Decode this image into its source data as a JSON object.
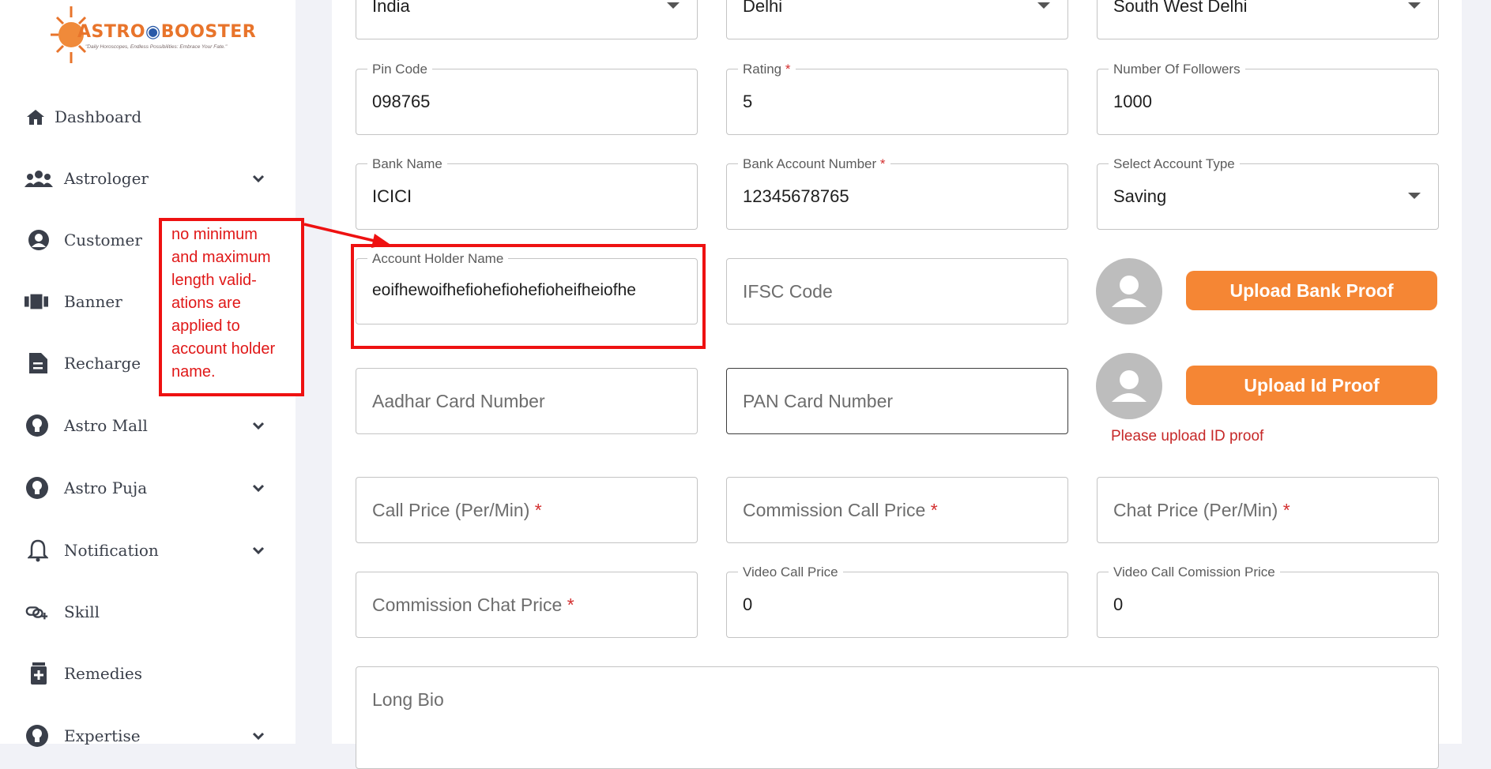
{
  "brand": {
    "name_part1": "ASTRO",
    "name_part2": "BOOSTER",
    "tagline": "\"Daily Horoscopes, Endless Possibilities: Embrace Your Fate.\""
  },
  "sidebar": {
    "items": [
      {
        "label": "Dashboard",
        "icon": "home-icon",
        "has_chevron": false
      },
      {
        "label": "Astrologer",
        "icon": "users-icon",
        "has_chevron": true
      },
      {
        "label": "Customer",
        "icon": "user-circle-icon",
        "has_chevron": false
      },
      {
        "label": "Banner",
        "icon": "banner-icon",
        "has_chevron": false
      },
      {
        "label": "Recharge",
        "icon": "document-icon",
        "has_chevron": false
      },
      {
        "label": "Astro Mall",
        "icon": "lightbulb-icon",
        "has_chevron": true
      },
      {
        "label": "Astro Puja",
        "icon": "lightbulb-icon",
        "has_chevron": true
      },
      {
        "label": "Notification",
        "icon": "bell-icon",
        "has_chevron": true
      },
      {
        "label": "Skill",
        "icon": "link-plus-icon",
        "has_chevron": false
      },
      {
        "label": "Remedies",
        "icon": "medical-icon",
        "has_chevron": false
      },
      {
        "label": "Expertise",
        "icon": "lightbulb-icon",
        "has_chevron": true
      }
    ]
  },
  "form": {
    "country": {
      "value": "India"
    },
    "state": {
      "value": "Delhi"
    },
    "city": {
      "value": "South West Delhi"
    },
    "pin_code": {
      "label": "Pin Code",
      "value": "098765"
    },
    "rating": {
      "label": "Rating",
      "required_mark": "*",
      "value": "5"
    },
    "followers": {
      "label": "Number Of Followers",
      "value": "1000"
    },
    "bank_name": {
      "label": "Bank Name",
      "value": "ICICI"
    },
    "bank_account_number": {
      "label": "Bank Account Number",
      "required_mark": "*",
      "value": "12345678765"
    },
    "account_type": {
      "label": "Select Account Type",
      "value": "Saving"
    },
    "account_holder_name": {
      "label": "Account Holder Name",
      "value": "eoifhewoifhefiohefiohefioheifheiofhe"
    },
    "ifsc_code": {
      "placeholder": "IFSC Code"
    },
    "upload_bank_proof": {
      "label": "Upload Bank Proof"
    },
    "aadhar": {
      "placeholder": "Aadhar Card Number"
    },
    "pan": {
      "placeholder": "PAN Card Number"
    },
    "upload_id_proof": {
      "label": "Upload Id Proof"
    },
    "id_proof_error": "Please upload ID proof",
    "call_price": {
      "placeholder": "Call Price (Per/Min)",
      "required_mark": "*"
    },
    "commission_call_price": {
      "placeholder": "Commission Call Price",
      "required_mark": "*"
    },
    "chat_price": {
      "placeholder": "Chat Price (Per/Min)",
      "required_mark": "*"
    },
    "commission_chat_price": {
      "placeholder": "Commission Chat Price",
      "required_mark": "*"
    },
    "video_call_price": {
      "label": "Video Call Price",
      "value": "0"
    },
    "video_call_commission": {
      "label": "Video Call Comission Price",
      "value": "0"
    },
    "long_bio": {
      "placeholder": "Long Bio"
    }
  },
  "annotation": {
    "lines": [
      "no minimum",
      "and maximum",
      "length valid-",
      "ations are",
      "applied to",
      "account holder",
      "name."
    ]
  },
  "colors": {
    "accent_orange": "#f58634",
    "error_red": "#c62828",
    "annotation_red": "#ee1111",
    "page_bg": "#f1f2f7"
  }
}
